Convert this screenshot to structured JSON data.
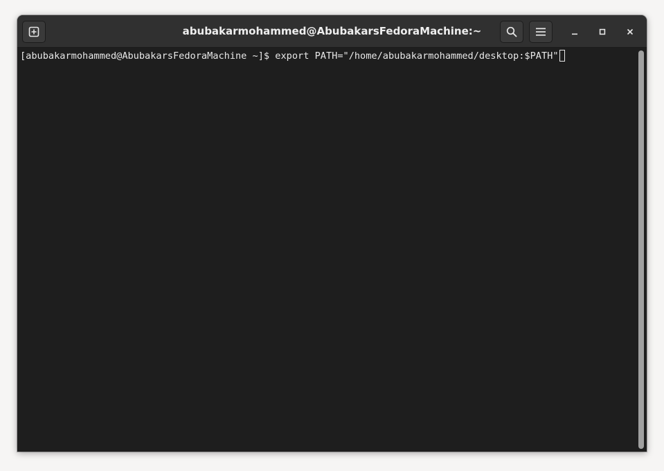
{
  "window": {
    "title": "abubakarmohammed@AbubakarsFedoraMachine:~"
  },
  "headerbar": {
    "new_tab_icon": "tab-new-icon",
    "search_icon": "search-icon",
    "menu_icon": "hamburger-menu-icon",
    "minimize_icon": "minimize-icon",
    "maximize_icon": "maximize-icon",
    "close_icon": "close-icon"
  },
  "terminal": {
    "prompt": "[abubakarmohammed@AbubakarsFedoraMachine ~]$ ",
    "command": "export PATH=\"/home/abubakarmohammed/desktop:$PATH\""
  },
  "colors": {
    "terminal_background": "#1e1e1e",
    "headerbar_background": "#303030",
    "text": "#e8e8e8"
  }
}
